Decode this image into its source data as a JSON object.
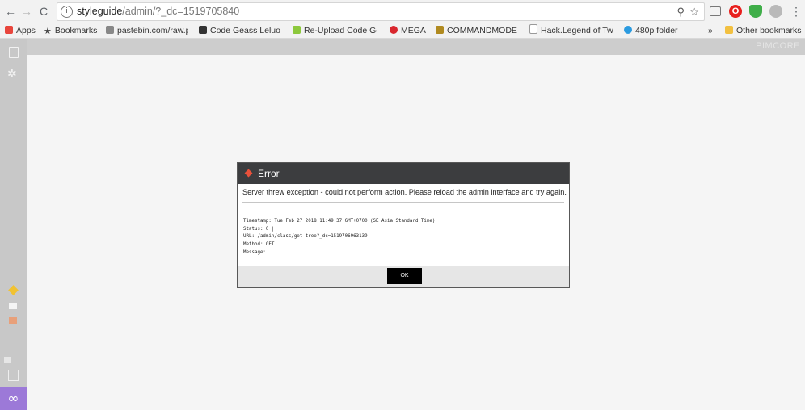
{
  "browser": {
    "url_host": "styleguide",
    "url_rest": "/admin/?_dc=1519705840",
    "zoom_glyph": "⚲",
    "star_glyph": "☆",
    "menu_glyph": "⋮"
  },
  "bookmarks": [
    {
      "label": "Apps",
      "icon": "apps-icon",
      "color": "#e8453c"
    },
    {
      "label": "Bookmarks",
      "icon": "star-icon",
      "color": "#555555"
    },
    {
      "label": "pastebin.com/raw.ph",
      "icon": "pastebin-icon",
      "color": "#888888"
    },
    {
      "label": "Code Geass Leluoch",
      "icon": "code-geass-icon",
      "color": "#333333"
    },
    {
      "label": "Re-Upload Code Gea",
      "icon": "reupload-icon",
      "color": "#8cc83c"
    },
    {
      "label": "MEGA",
      "icon": "mega-icon",
      "color": "#d9272e"
    },
    {
      "label": "COMMANDMODE - \\",
      "icon": "commandmode-icon",
      "color": "#b08a20"
    },
    {
      "label": "Hack.Legend of Twili",
      "icon": "page-icon",
      "color": "#999999"
    },
    {
      "label": "480p folder",
      "icon": "folder-blue-icon",
      "color": "#2b9be0"
    },
    {
      "label": "Other bookmarks",
      "icon": "folder-icon",
      "color": "#f2c040"
    }
  ],
  "bookmarks_overflow": "»",
  "app": {
    "brand_text": "PIMCORE"
  },
  "dialog": {
    "title": "Error",
    "message": "Server threw exception - could not perform action. Please reload the admin interface and try again.",
    "details": [
      "Timestamp: Tue Feb 27 2018 11:49:37 GMT+0700 (SE Asia Standard Time)",
      "Status: 0 |",
      "URL: /admin/class/get-tree?_dc=1519706963139",
      "Method: GET",
      "Message:"
    ],
    "ok_label": "OK"
  }
}
